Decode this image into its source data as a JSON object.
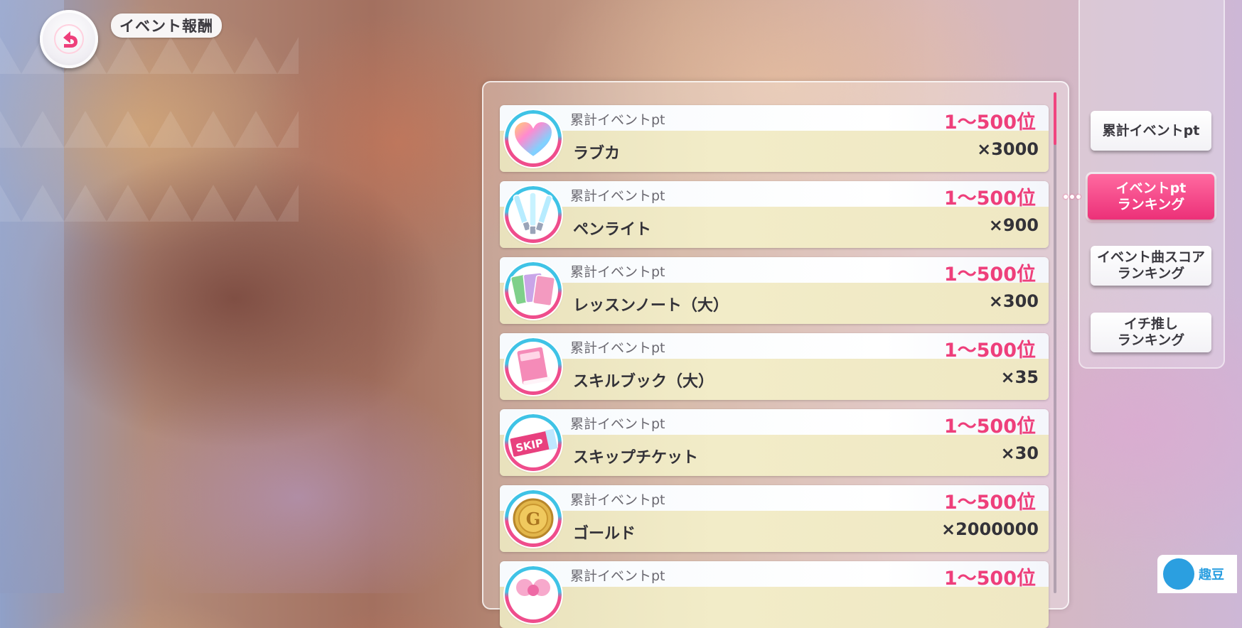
{
  "header": {
    "title": "イベント報酬"
  },
  "rewards": [
    {
      "condition": "累計イベントpt",
      "rank": "1～500位",
      "name": "ラブカ",
      "qty": "×3000",
      "icon": "love-card-heart-icon"
    },
    {
      "condition": "累計イベントpt",
      "rank": "1～500位",
      "name": "ペンライト",
      "qty": "×900",
      "icon": "penlight-icon"
    },
    {
      "condition": "累計イベントpt",
      "rank": "1～500位",
      "name": "レッスンノート（大）",
      "qty": "×300",
      "icon": "lesson-note-icon"
    },
    {
      "condition": "累計イベントpt",
      "rank": "1～500位",
      "name": "スキルブック（大）",
      "qty": "×35",
      "icon": "skill-book-icon"
    },
    {
      "condition": "累計イベントpt",
      "rank": "1～500位",
      "name": "スキップチケット",
      "qty": "×30",
      "icon": "skip-ticket-icon"
    },
    {
      "condition": "累計イベントpt",
      "rank": "1～500位",
      "name": "ゴールド",
      "qty": "×2000000",
      "icon": "gold-coin-icon"
    },
    {
      "condition": "累計イベントpt",
      "rank": "1～500位",
      "name": "",
      "qty": "",
      "icon": "ribbon-item-icon"
    }
  ],
  "tabs": [
    {
      "label": "累計イベントpt",
      "active": false
    },
    {
      "label": "イベントpt\nランキング",
      "active": true
    },
    {
      "label": "イベント曲スコア\nランキング",
      "active": false
    },
    {
      "label": "イチ推し\nランキング",
      "active": false
    }
  ],
  "watermark": {
    "text": "趣豆"
  },
  "colors": {
    "accent": "#ee3f7b",
    "ring_blue": "#3fc3e6"
  }
}
